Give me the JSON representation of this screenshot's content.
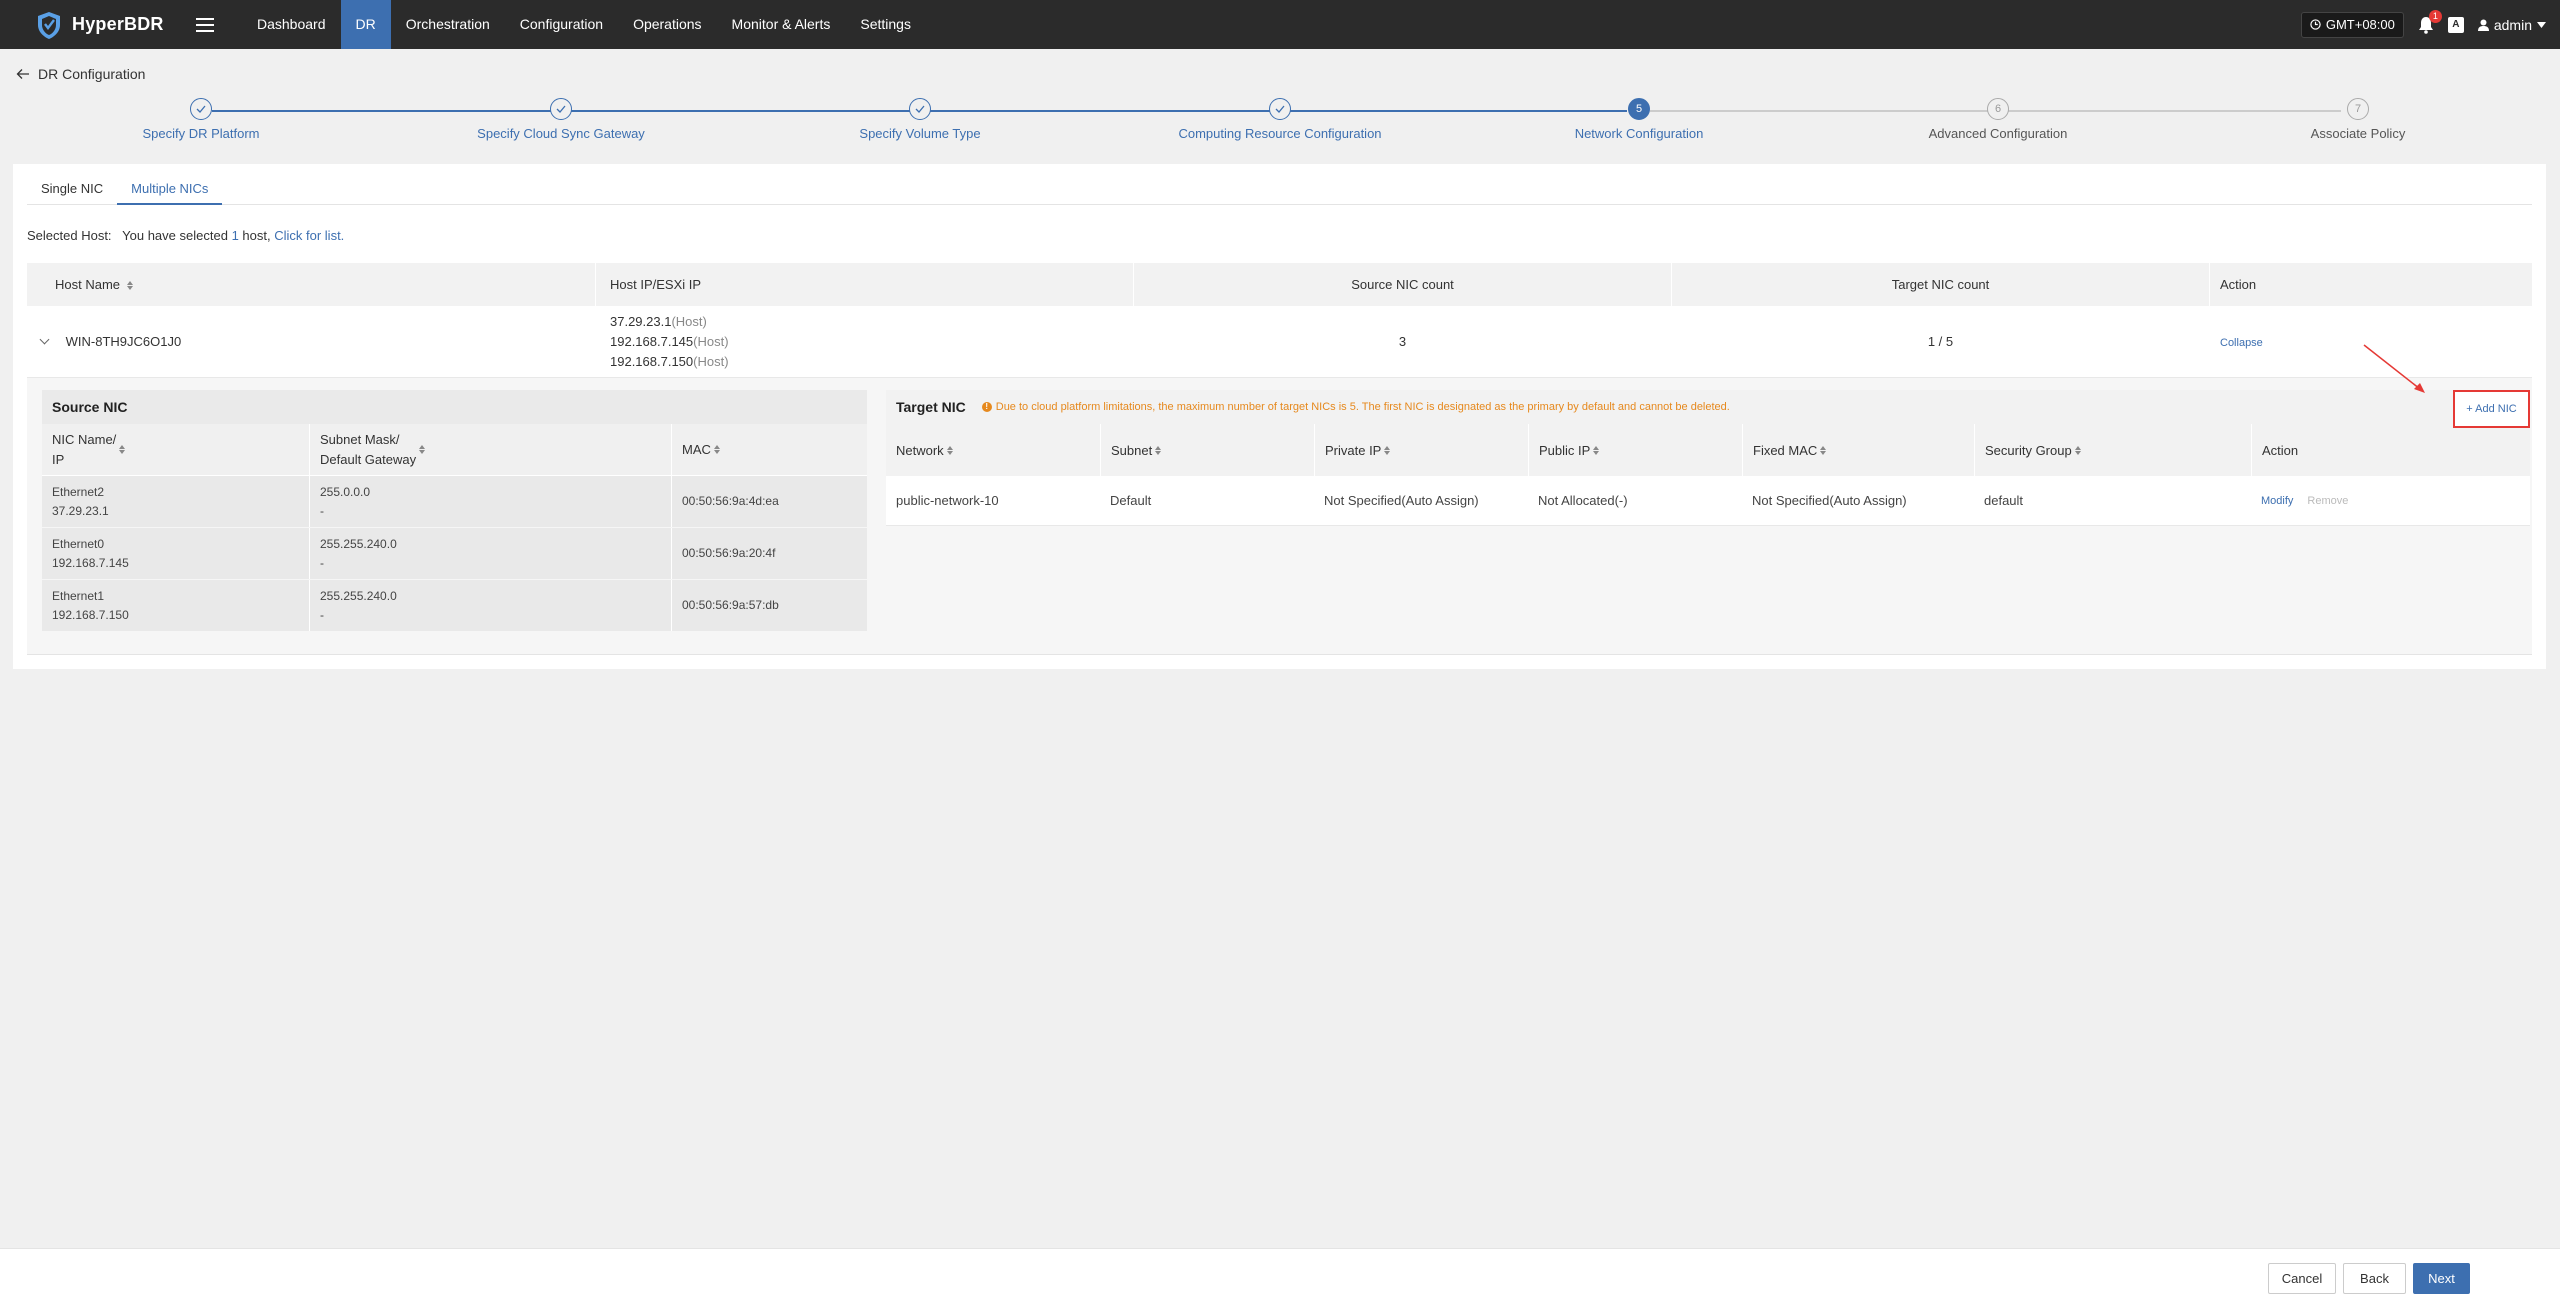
{
  "app": {
    "name": "HyperBDR"
  },
  "nav": {
    "items": [
      {
        "label": "Dashboard",
        "active": false
      },
      {
        "label": "DR",
        "active": true
      },
      {
        "label": "Orchestration",
        "active": false
      },
      {
        "label": "Configuration",
        "active": false
      },
      {
        "label": "Operations",
        "active": false
      },
      {
        "label": "Monitor & Alerts",
        "active": false
      },
      {
        "label": "Settings",
        "active": false
      }
    ],
    "timezone": "GMT+08:00",
    "notification_count": "1",
    "lang_icon": "A",
    "user": "admin"
  },
  "breadcrumb": {
    "title": "DR Configuration"
  },
  "steps": [
    {
      "index": "1",
      "label": "Specify DR Platform",
      "status": "done"
    },
    {
      "index": "2",
      "label": "Specify Cloud Sync Gateway",
      "status": "done"
    },
    {
      "index": "3",
      "label": "Specify Volume Type",
      "status": "done"
    },
    {
      "index": "4",
      "label": "Computing Resource Configuration",
      "status": "done"
    },
    {
      "index": "5",
      "label": "Network Configuration",
      "status": "current"
    },
    {
      "index": "6",
      "label": "Advanced Configuration",
      "status": "todo"
    },
    {
      "index": "7",
      "label": "Associate Policy",
      "status": "todo"
    }
  ],
  "tabs": [
    {
      "label": "Single NIC",
      "active": false
    },
    {
      "label": "Multiple NICs",
      "active": true
    }
  ],
  "selected_host": {
    "label": "Selected Host:",
    "prefix": "You have selected",
    "count": "1",
    "suffix": "host,",
    "link": "Click for list."
  },
  "host_table": {
    "headers": [
      "Host Name",
      "Host IP/ESXi IP",
      "Source NIC count",
      "Target NIC count",
      "Action"
    ],
    "row": {
      "name": "WIN-8TH9JC6O1J0",
      "ips": [
        {
          "ip": "37.29.23.1",
          "tag": "(Host)"
        },
        {
          "ip": "192.168.7.145",
          "tag": "(Host)"
        },
        {
          "ip": "192.168.7.150",
          "tag": "(Host)"
        }
      ],
      "source_nic_count": "3",
      "target_nic_count": "1 / 5",
      "action": "Collapse"
    }
  },
  "source_nic": {
    "title": "Source NIC",
    "headers": {
      "name_line1": "NIC Name/",
      "name_line2": "IP",
      "mask_line1": "Subnet Mask/",
      "mask_line2": "Default Gateway",
      "mac": "MAC"
    },
    "rows": [
      {
        "name": "Ethernet2",
        "ip": "37.29.23.1",
        "mask": "255.0.0.0",
        "gateway": "-",
        "mac": "00:50:56:9a:4d:ea"
      },
      {
        "name": "Ethernet0",
        "ip": "192.168.7.145",
        "mask": "255.255.240.0",
        "gateway": "-",
        "mac": "00:50:56:9a:20:4f"
      },
      {
        "name": "Ethernet1",
        "ip": "192.168.7.150",
        "mask": "255.255.240.0",
        "gateway": "-",
        "mac": "00:50:56:9a:57:db"
      }
    ]
  },
  "target_nic": {
    "title": "Target NIC",
    "warning": "Due to cloud platform limitations, the maximum number of target NICs is 5. The first NIC is designated as the primary by default and cannot be deleted.",
    "add_button": "+ Add NIC",
    "headers": [
      "Network",
      "Subnet",
      "Private IP",
      "Public IP",
      "Fixed MAC",
      "Security Group",
      "Action"
    ],
    "row": {
      "network": "public-network-10",
      "subnet": "Default",
      "private_ip": "Not Specified(Auto Assign)",
      "public_ip": "Not Allocated(-)",
      "fixed_mac": "Not Specified(Auto Assign)",
      "security_group": "default",
      "modify": "Modify",
      "remove": "Remove"
    }
  },
  "footer": {
    "cancel": "Cancel",
    "back": "Back",
    "next": "Next"
  },
  "colors": {
    "accent": "#3d6fb0",
    "topbar": "#2b2b2b",
    "warning": "#e6891e",
    "highlight": "#e53935"
  }
}
